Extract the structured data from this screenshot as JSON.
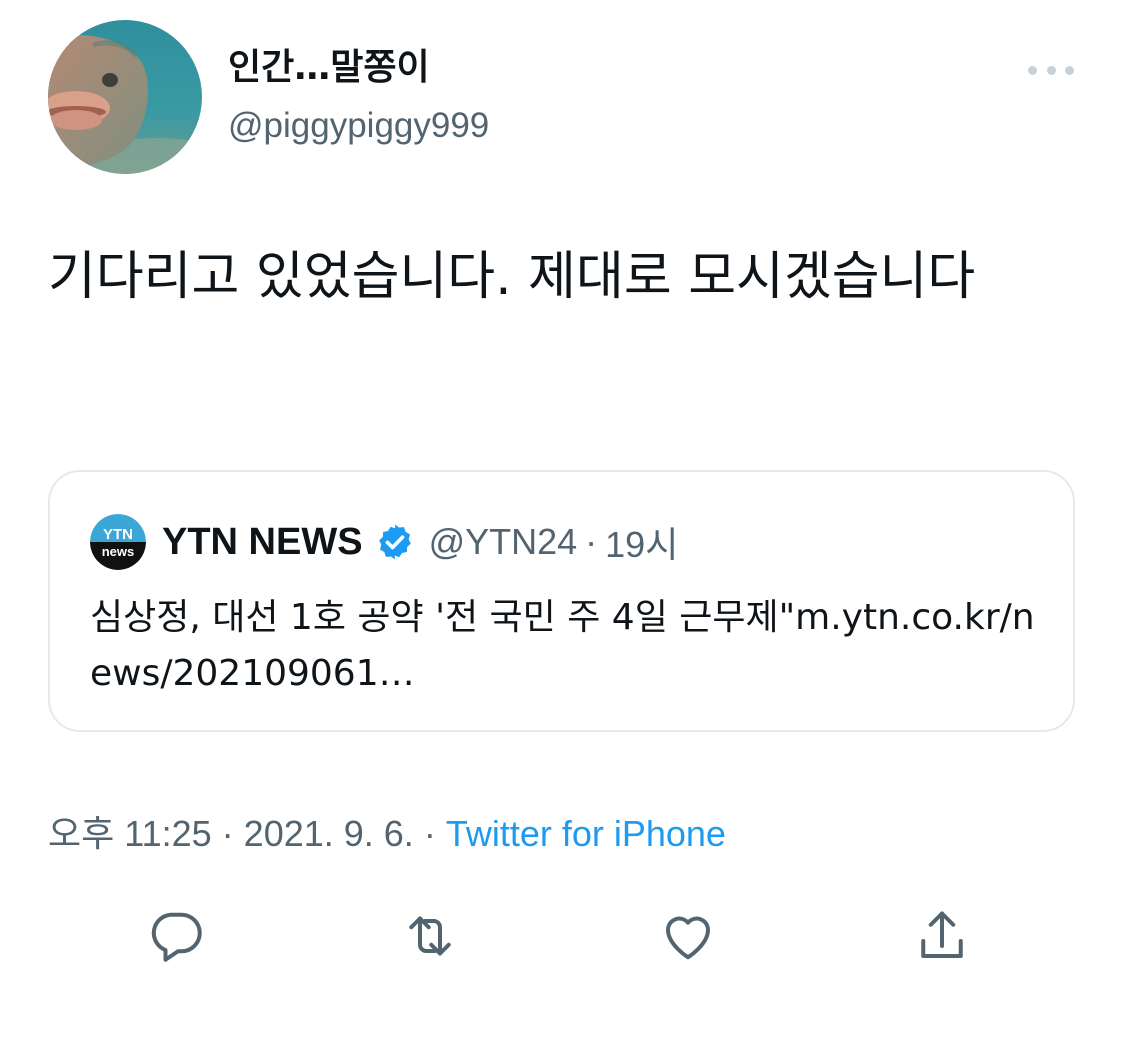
{
  "tweet": {
    "author": {
      "display_name": "인간…말쫑이",
      "handle": "@piggypiggy999"
    },
    "text": "기다리고 있었습니다. 제대로 모시겠습니다",
    "quoted": {
      "author_name": "YTN NEWS",
      "author_handle": "@YTN24",
      "separator": "·",
      "time": "19시",
      "avatar_text_top": "YTN",
      "avatar_text_bottom": "news",
      "text": "심상정, 대선 1호 공약 '전 국민 주 4일 근무제\"m.ytn.co.kr/news/202109061…"
    },
    "meta": {
      "time": "오후 11:25",
      "sep1": " · ",
      "date": "2021. 9. 6.",
      "sep2": " · ",
      "source": "Twitter for iPhone"
    }
  },
  "actions": [
    "reply-icon",
    "retweet-icon",
    "like-icon",
    "share-icon"
  ],
  "colors": {
    "text": "#0f1419",
    "secondary": "#536471",
    "accent": "#1d9bf0",
    "border": "#e4e9ed"
  }
}
